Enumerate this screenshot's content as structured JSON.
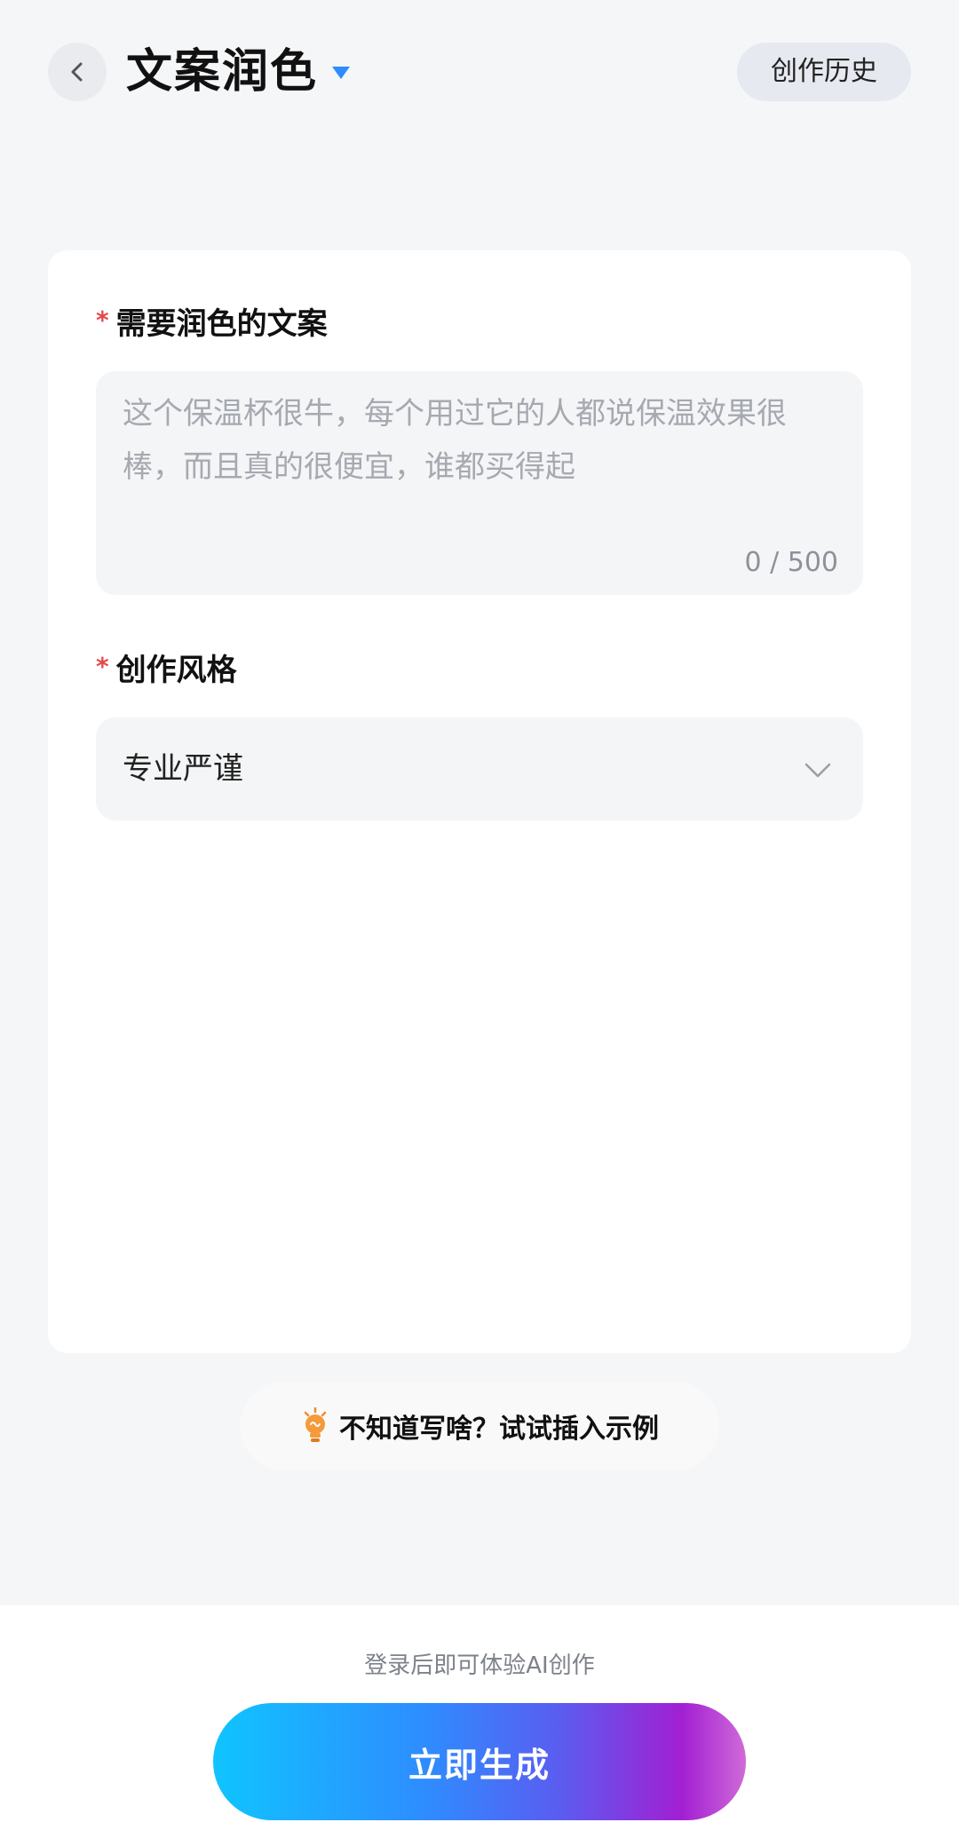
{
  "header": {
    "title": "文案润色",
    "history_label": "创作历史"
  },
  "form": {
    "copy_field": {
      "required_mark": "*",
      "label": "需要润色的文案",
      "value": "",
      "placeholder": "这个保温杯很牛，每个用过它的人都说保温效果很棒，而且真的很便宜，谁都买得起",
      "counter": "0 / 500"
    },
    "style_field": {
      "required_mark": "*",
      "label": "创作风格",
      "selected": "专业严谨"
    }
  },
  "hint": {
    "text": "不知道写啥？试试插入示例"
  },
  "footer": {
    "login_note": "登录后即可体验AI创作",
    "generate_label": "立即生成"
  },
  "colors": {
    "accent": "#2e8cff",
    "required": "#e5484d",
    "button_gradient": [
      "#10c4ff",
      "#2e8cff",
      "#5a5df0",
      "#a21fd3"
    ]
  }
}
